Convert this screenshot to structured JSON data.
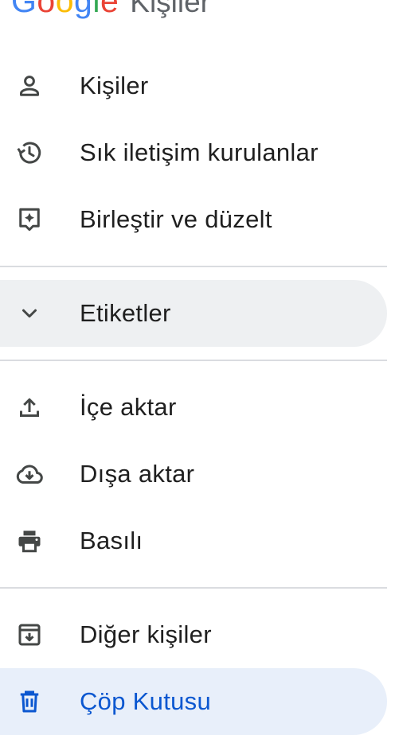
{
  "brand": {
    "logo_letters": [
      "G",
      "o",
      "o",
      "g",
      "l",
      "e"
    ],
    "logo_colors": [
      "#4285F4",
      "#EA4335",
      "#FBBC05",
      "#4285F4",
      "#34A853",
      "#EA4335"
    ],
    "app_name": "Kişiler"
  },
  "nav": {
    "contacts": {
      "label": "Kişiler",
      "icon": "person-icon"
    },
    "frequent": {
      "label": "Sık iletişim kurulanlar",
      "icon": "history-icon"
    },
    "merge": {
      "label": "Birleştir ve düzelt",
      "icon": "merge-fix-icon"
    },
    "labels": {
      "label": "Etiketler",
      "icon": "chevron-down-icon"
    },
    "import": {
      "label": "İçe aktar",
      "icon": "upload-icon"
    },
    "export": {
      "label": "Dışa aktar",
      "icon": "cloud-download-icon"
    },
    "print": {
      "label": "Basılı",
      "icon": "printer-icon"
    },
    "other": {
      "label": "Diğer kişiler",
      "icon": "archive-download-icon"
    },
    "trash": {
      "label": "Çöp Kutusu",
      "icon": "trash-icon"
    }
  },
  "colors": {
    "text": "#1f1f1f",
    "icon": "#444746",
    "active": "#0b57d0"
  }
}
